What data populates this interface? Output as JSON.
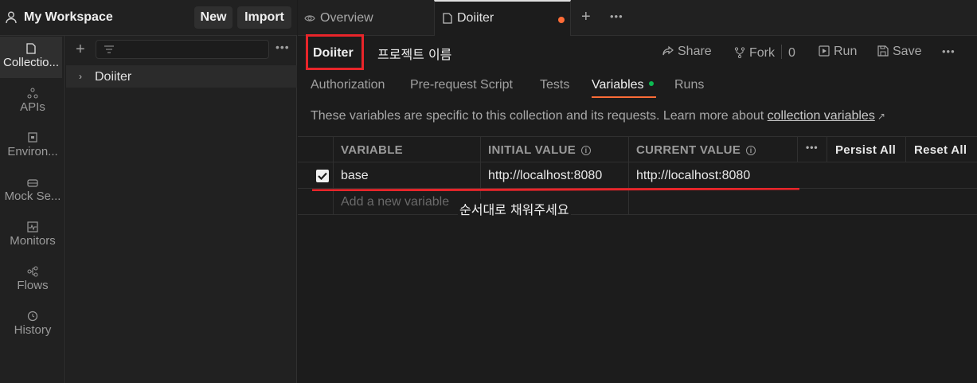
{
  "workspace": {
    "title": "My Workspace",
    "new_label": "New",
    "import_label": "Import",
    "user_icon": "user-icon"
  },
  "rail": {
    "items": [
      {
        "label": "Collectio...",
        "icon": "collection-icon"
      },
      {
        "label": "APIs",
        "icon": "api-icon"
      },
      {
        "label": "Environ...",
        "icon": "environment-icon"
      },
      {
        "label": "Mock Se...",
        "icon": "mock-server-icon"
      },
      {
        "label": "Monitors",
        "icon": "monitor-icon"
      },
      {
        "label": "Flows",
        "icon": "flows-icon"
      },
      {
        "label": "History",
        "icon": "history-icon"
      }
    ]
  },
  "tree": {
    "items": [
      {
        "label": "Doiiter"
      }
    ]
  },
  "tabs": {
    "overview": "Overview",
    "doiiter": "Doiiter"
  },
  "collection": {
    "name": "Doiiter",
    "annotation": "프로젝트 이름",
    "share": "Share",
    "fork": "Fork",
    "fork_count": "0",
    "run": "Run",
    "save": "Save"
  },
  "subtabs": {
    "authorization": "Authorization",
    "pre_request": "Pre-request Script",
    "tests": "Tests",
    "variables": "Variables",
    "runs": "Runs"
  },
  "description": {
    "text": "These variables are specific to this collection and its requests. Learn more about ",
    "link": "collection variables",
    "arrow": "↗"
  },
  "table": {
    "headers": {
      "variable": "VARIABLE",
      "initial": "INITIAL VALUE",
      "current": "CURRENT VALUE",
      "persist_all": "Persist All",
      "reset_all": "Reset All"
    },
    "rows": [
      {
        "variable": "base",
        "initial": "http://localhost:8080",
        "current": "http://localhost:8080",
        "checked": true
      }
    ],
    "new_placeholder": "Add a new variable"
  },
  "annotations": {
    "order": "순서대로 채워주세요"
  },
  "colors": {
    "accent": "#ff6c37",
    "annotation_red": "#e8252a",
    "variables_dot": "#0cbb52"
  }
}
